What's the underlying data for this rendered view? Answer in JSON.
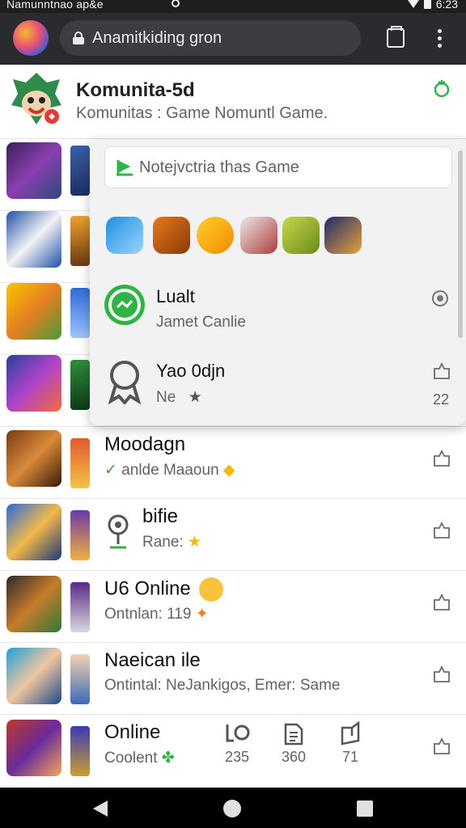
{
  "status_bar": {
    "left_text": "Namunntnao ap&e",
    "time": "6:23"
  },
  "browser": {
    "url": "Anamitkiding gron"
  },
  "header": {
    "title": "Komunita-5d",
    "subtitle": "Komunitas : Game Nomuntl Game."
  },
  "popup": {
    "search_placeholder": "Notejvctria thas Game",
    "items": [
      {
        "title": "Lualt",
        "subtitle": "Jamet Canlie",
        "trailing": ""
      },
      {
        "title": "Yao 0djn",
        "subtitle": "Ne",
        "trailing": "22"
      }
    ]
  },
  "rows": [
    {
      "title": "Moodagn",
      "subtitle": "anlde Maaoun"
    },
    {
      "title": "bifie",
      "subtitle": "Rane:"
    },
    {
      "title": "U6 Online",
      "subtitle": "Ontnlan: 119"
    },
    {
      "title": "Naeican ile",
      "subtitle": "Ontintal: NeJankigos, Emer: Same"
    },
    {
      "title": "Online",
      "subtitle": "Coolent",
      "stats": [
        "235",
        "360",
        "71"
      ]
    }
  ],
  "colors": {
    "accent_green": "#2fb344",
    "dark_bar": "#2a2b2e",
    "star": "#f5b800"
  }
}
